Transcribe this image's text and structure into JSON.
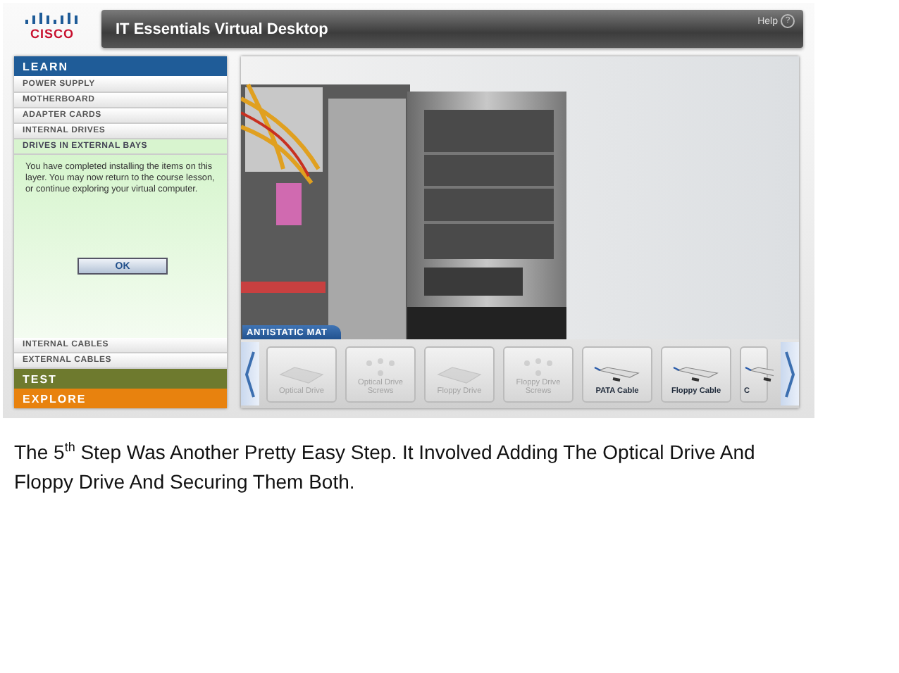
{
  "header": {
    "logo": "CISCO",
    "title": "IT Essentials Virtual Desktop",
    "help": "Help",
    "help_icon": "?"
  },
  "sidebar": {
    "sections": [
      {
        "title": "LEARN",
        "color": "#1f5c98",
        "expanded": true,
        "items": [
          {
            "label": "POWER SUPPLY",
            "selected": false
          },
          {
            "label": "MOTHERBOARD",
            "selected": false
          },
          {
            "label": "ADAPTER CARDS",
            "selected": false
          },
          {
            "label": "INTERNAL DRIVES",
            "selected": false
          },
          {
            "label": "DRIVES IN EXTERNAL BAYS",
            "selected": true
          },
          {
            "label": "INTERNAL CABLES",
            "selected": false
          },
          {
            "label": "EXTERNAL CABLES",
            "selected": false
          }
        ],
        "panel": {
          "message": "You have completed installing the items on this layer. You may now return to the course lesson, or continue exploring your virtual computer.",
          "button": "OK"
        }
      },
      {
        "title": "TEST",
        "color": "#6e7a2e",
        "expanded": false
      },
      {
        "title": "EXPLORE",
        "color": "#e8820e",
        "expanded": false
      }
    ]
  },
  "stage": {
    "scene_label": "ANTISTATIC MAT",
    "tray": [
      {
        "label": "Optical Drive",
        "kind": "drive",
        "disabled": true
      },
      {
        "label": "Optical Drive Screws",
        "kind": "screws",
        "disabled": true
      },
      {
        "label": "Floppy Drive",
        "kind": "drive",
        "disabled": true
      },
      {
        "label": "Floppy Drive Screws",
        "kind": "screws",
        "disabled": true
      },
      {
        "label": "PATA Cable",
        "kind": "cable",
        "disabled": false
      },
      {
        "label": "Floppy Cable",
        "kind": "cable",
        "disabled": false
      },
      {
        "label": "C",
        "kind": "cable",
        "disabled": false
      }
    ]
  },
  "caption": "The 5$^{th}$ Step Was Another Pretty Easy Step. It Involved Adding The Optical Drive And Floppy Drive And Securing Them Both."
}
